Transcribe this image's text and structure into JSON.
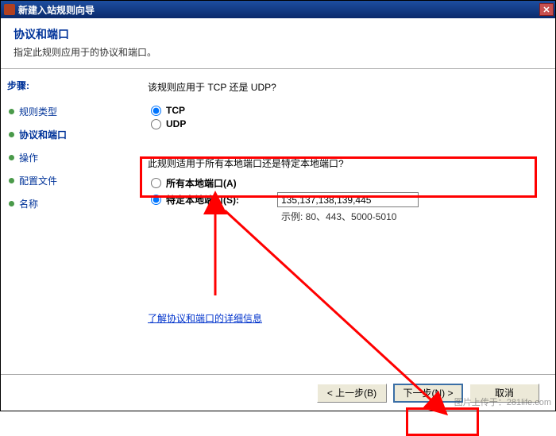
{
  "window": {
    "title": "新建入站规则向导"
  },
  "header": {
    "title": "协议和端口",
    "desc": "指定此规则应用于的协议和端口。"
  },
  "sidebar": {
    "stepsLabel": "步骤:",
    "items": [
      {
        "label": "规则类型"
      },
      {
        "label": "协议和端口"
      },
      {
        "label": "操作"
      },
      {
        "label": "配置文件"
      },
      {
        "label": "名称"
      }
    ]
  },
  "content": {
    "q1": "该规则应用于 TCP 还是 UDP?",
    "tcp": "TCP",
    "udp": "UDP",
    "q2": "此规则适用于所有本地端口还是特定本地端口?",
    "allPorts": "所有本地端口(A)",
    "specificPorts": "特定本地端口(S):",
    "portValue": "135,137,138,139,445",
    "example": "示例: 80、443、5000-5010",
    "learnMore": "了解协议和端口的详细信息"
  },
  "footer": {
    "back": "< 上一步(B)",
    "next": "下一步(N) >",
    "cancel": "取消"
  },
  "watermark": "图片上传于：281life.com"
}
